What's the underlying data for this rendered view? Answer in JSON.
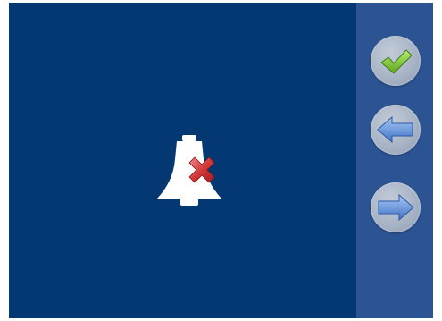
{
  "screen": {
    "background_color": "#033873",
    "side_panel_color": "#2c5392"
  },
  "main": {
    "status_icon": "bell-muted-icon",
    "overlay_icon": "red-x-icon"
  },
  "side_panel": {
    "buttons": [
      {
        "name": "confirm",
        "icon": "checkmark-icon",
        "accent": "#7dc23a"
      },
      {
        "name": "back",
        "icon": "arrow-left-icon",
        "accent": "#5b8ed6"
      },
      {
        "name": "forward",
        "icon": "arrow-right-icon",
        "accent": "#5b8ed6"
      }
    ]
  }
}
